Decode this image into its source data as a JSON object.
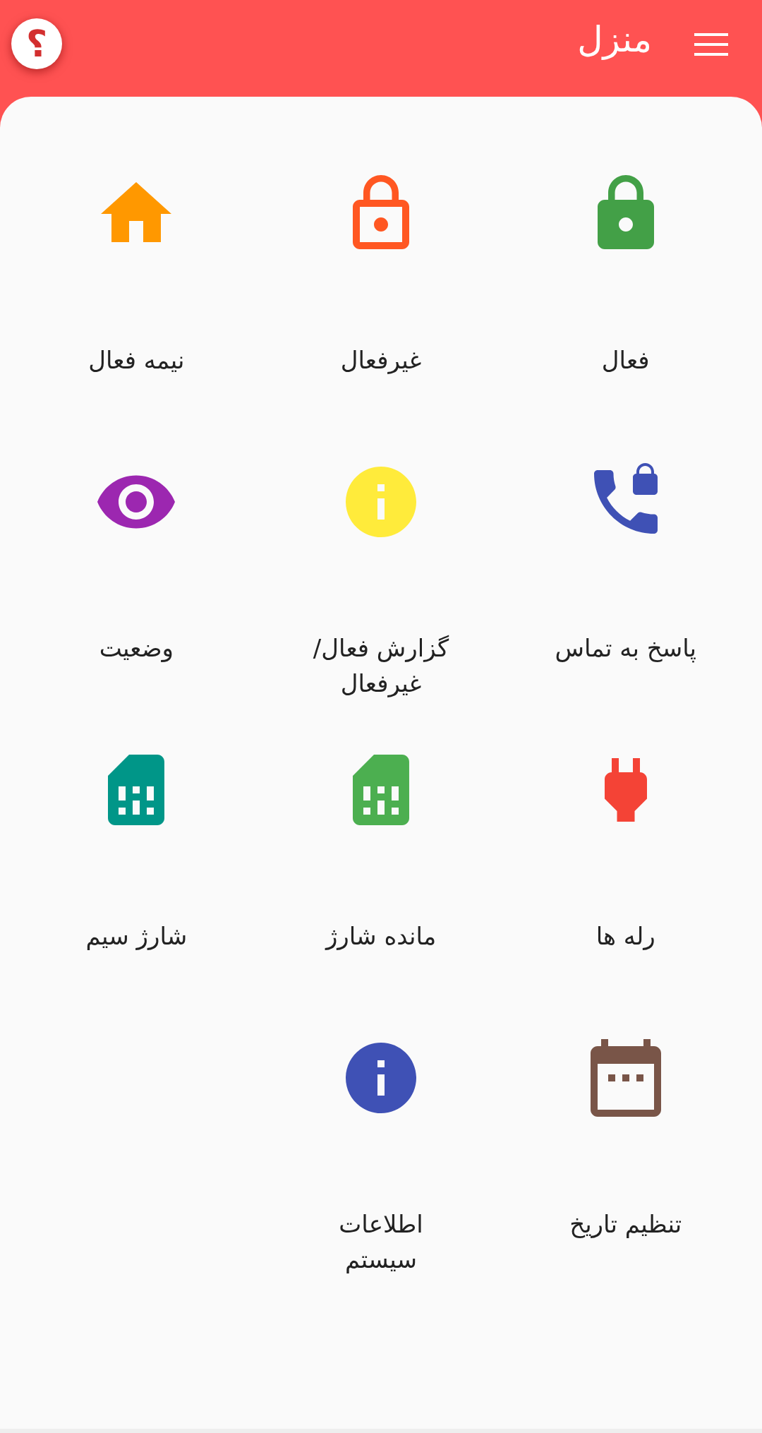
{
  "header": {
    "title": "منزل",
    "help": "؟"
  },
  "items": [
    {
      "label": "فعال",
      "kind": "lock",
      "color": "#43a047"
    },
    {
      "label": "غیرفعال",
      "kind": "unlock",
      "color": "#ff5722"
    },
    {
      "label": "نیمه فعال",
      "kind": "home",
      "color": "#ff9800"
    },
    {
      "label": "پاسخ به تماس",
      "kind": "phone-lock",
      "color": "#3f51b5"
    },
    {
      "label": "گزارش فعال/ غیرفعال",
      "kind": "info",
      "color": "#ffeb3b"
    },
    {
      "label": "وضعیت",
      "kind": "eye",
      "color": "#9c27b0"
    },
    {
      "label": "رله ها",
      "kind": "plug",
      "color": "#f44336"
    },
    {
      "label": "مانده شارژ",
      "kind": "sim",
      "color": "#4caf50"
    },
    {
      "label": "شارژ سیم",
      "kind": "sim",
      "color": "#009688"
    },
    {
      "label": "تنظیم تاریخ",
      "kind": "calendar",
      "color": "#795548"
    },
    {
      "label": "اطلاعات سیستم",
      "kind": "info",
      "color": "#3f51b5"
    }
  ]
}
